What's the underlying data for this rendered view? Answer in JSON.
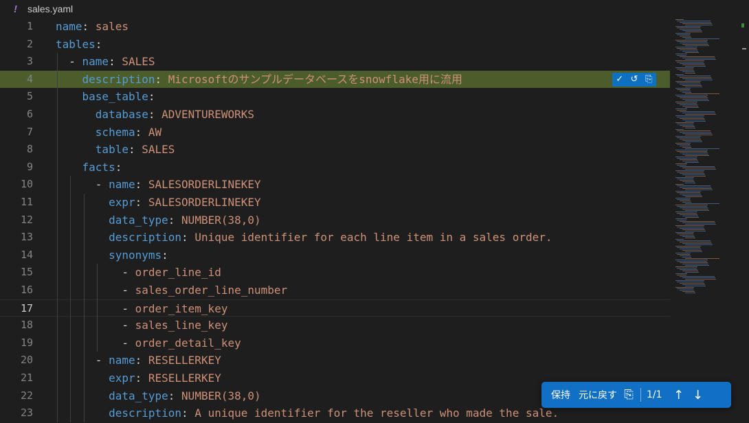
{
  "breadcrumb": {
    "icon": "!",
    "file_name": "sales.yaml"
  },
  "colors": {
    "key": "#569cd6",
    "value": "#ce9178",
    "highlight": "#4b5d2a",
    "accent": "#1170c4"
  },
  "lines": [
    {
      "n": "1",
      "indent": "",
      "dash": "",
      "key": "name",
      "value": "sales"
    },
    {
      "n": "2",
      "indent": "",
      "dash": "",
      "key": "tables",
      "value": ""
    },
    {
      "n": "3",
      "indent": "  ",
      "dash": "- ",
      "key": "name",
      "value": "SALES"
    },
    {
      "n": "4",
      "indent": "    ",
      "dash": "",
      "key": "description",
      "value": "Microsoftのサンプルデータベースをsnowflake用に流用"
    },
    {
      "n": "5",
      "indent": "    ",
      "dash": "",
      "key": "base_table",
      "value": ""
    },
    {
      "n": "6",
      "indent": "      ",
      "dash": "",
      "key": "database",
      "value": "ADVENTUREWORKS"
    },
    {
      "n": "7",
      "indent": "      ",
      "dash": "",
      "key": "schema",
      "value": "AW"
    },
    {
      "n": "8",
      "indent": "      ",
      "dash": "",
      "key": "table",
      "value": "SALES"
    },
    {
      "n": "9",
      "indent": "    ",
      "dash": "",
      "key": "facts",
      "value": ""
    },
    {
      "n": "10",
      "indent": "      ",
      "dash": "- ",
      "key": "name",
      "value": "SALESORDERLINEKEY"
    },
    {
      "n": "11",
      "indent": "        ",
      "dash": "",
      "key": "expr",
      "value": "SALESORDERLINEKEY"
    },
    {
      "n": "12",
      "indent": "        ",
      "dash": "",
      "key": "data_type",
      "value": "NUMBER(38,0)"
    },
    {
      "n": "13",
      "indent": "        ",
      "dash": "",
      "key": "description",
      "value": "Unique identifier for each line item in a sales order."
    },
    {
      "n": "14",
      "indent": "        ",
      "dash": "",
      "key": "synonyms",
      "value": ""
    },
    {
      "n": "15",
      "indent": "          ",
      "dash": "- ",
      "key": "",
      "value": "order_line_id"
    },
    {
      "n": "16",
      "indent": "          ",
      "dash": "- ",
      "key": "",
      "value": "sales_order_line_number"
    },
    {
      "n": "17",
      "indent": "          ",
      "dash": "- ",
      "key": "",
      "value": "order_item_key"
    },
    {
      "n": "18",
      "indent": "          ",
      "dash": "- ",
      "key": "",
      "value": "sales_line_key"
    },
    {
      "n": "19",
      "indent": "          ",
      "dash": "- ",
      "key": "",
      "value": "order_detail_key"
    },
    {
      "n": "20",
      "indent": "      ",
      "dash": "- ",
      "key": "name",
      "value": "RESELLERKEY"
    },
    {
      "n": "21",
      "indent": "        ",
      "dash": "",
      "key": "expr",
      "value": "RESELLERKEY"
    },
    {
      "n": "22",
      "indent": "        ",
      "dash": "",
      "key": "data_type",
      "value": "NUMBER(38,0)"
    },
    {
      "n": "23",
      "indent": "        ",
      "dash": "",
      "key": "description",
      "value": "A unique identifier for the reseller who made the sale."
    }
  ],
  "active_line": "17",
  "highlighted_line": "4",
  "inline_actions": {
    "accept_icon": "✓",
    "undo_icon": "↺",
    "copy_icon": "⎘"
  },
  "diff_toolbar": {
    "keep_label": "保持",
    "undo_label": "元に戻す",
    "copy_icon": "⎘",
    "counter": "1/1",
    "prev_icon": "↑",
    "next_icon": "↓"
  }
}
